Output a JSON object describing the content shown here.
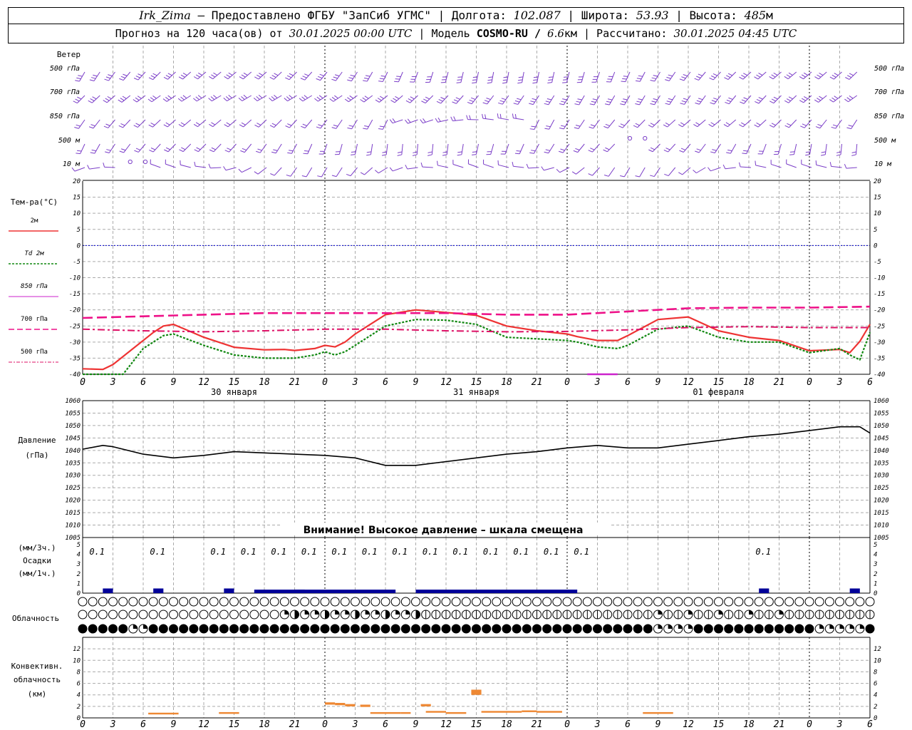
{
  "header": {
    "station": "Irk_Zima",
    "provided_label": "– Предоставлено ФГБУ \"ЗапСиб УГМС\"",
    "lon_label": "| Долгота:",
    "lon_value": "102.087",
    "lat_label": "| Широта:",
    "lat_value": "53.93",
    "alt_label": "| Высота:",
    "alt_value": "485",
    "alt_unit": "м",
    "forecast_label": "Прогноз на 120 часа(ов) от",
    "forecast_start": "30.01.2025 00:00 UTC",
    "model_label": "| Модель",
    "model_name": "COSMO-RU /",
    "model_res": "6.6",
    "model_res_unit": "км",
    "calc_label": "| Рассчитано:",
    "calc_time": "30.01.2025 04:45 UTC"
  },
  "colors": {
    "wind": "#7b3ec8",
    "t2m": "#ee3333",
    "td2m": "#118811",
    "t850": "#cc22cc",
    "t700": "#ee1188",
    "t500": "#dd1166",
    "pressure": "#000000",
    "precip": "#000099",
    "conv": "#ee8833",
    "zero": "#0000cc",
    "grid": "#aaaaaa"
  },
  "chart_data": [
    {
      "type": "wind_barbs",
      "title": "Ветер",
      "levels": [
        "500 гПа",
        "700 гПа",
        "850 гПа",
        "500 м",
        "10  м"
      ],
      "calm_markers_note": "o",
      "description_markers": "barb symbols drawn per 3h step"
    },
    {
      "type": "line",
      "title": "Тем-ра(°C)",
      "ylim": [
        -40,
        20
      ],
      "yticks": [
        20,
        15,
        10,
        5,
        0,
        -5,
        -10,
        -15,
        -20,
        -25,
        -30,
        -35,
        -40
      ],
      "x_ticks": [
        "0",
        "3",
        "6",
        "9",
        "12",
        "15",
        "18",
        "21",
        "0",
        "3",
        "6",
        "9",
        "12",
        "15",
        "18",
        "21",
        "0",
        "3",
        "6",
        "9",
        "12",
        "15",
        "18",
        "21",
        "0",
        "3",
        "6"
      ],
      "x_range_hours": [
        0,
        78
      ],
      "dates": [
        {
          "label": "30 января",
          "hour": 15
        },
        {
          "label": "31 января",
          "hour": 39
        },
        {
          "label": "01 февраля",
          "hour": 63
        }
      ],
      "series": [
        {
          "name": "2м",
          "key": "t2m",
          "x": [
            0,
            2,
            3,
            5,
            7,
            8,
            9,
            12,
            15,
            18,
            20,
            21,
            23,
            24,
            25,
            26,
            27,
            30,
            33,
            36,
            39,
            42,
            45,
            48,
            49,
            51,
            53,
            54,
            57,
            60,
            63,
            66,
            69,
            72,
            75,
            76,
            77,
            78
          ],
          "values": [
            -38.3,
            -38.5,
            -37,
            -32,
            -27,
            -25,
            -24.5,
            -28.5,
            -31.6,
            -32.4,
            -32.3,
            -32.6,
            -32,
            -31,
            -31.5,
            -30,
            -27.5,
            -21.5,
            -20,
            -20.8,
            -21.7,
            -25,
            -26.5,
            -27.5,
            -28.3,
            -29.5,
            -29.5,
            -28,
            -23,
            -22.2,
            -26.5,
            -28.5,
            -29.5,
            -32.7,
            -32.3,
            -33.3,
            -29.8,
            -24.5
          ]
        },
        {
          "name": "Td 2м",
          "key": "td2m",
          "x": [
            0,
            3,
            4,
            6,
            8,
            9,
            12,
            15,
            18,
            21,
            23,
            24,
            25,
            26,
            27,
            30,
            33,
            36,
            39,
            42,
            45,
            48,
            49,
            51,
            53,
            54,
            57,
            60,
            63,
            66,
            69,
            72,
            75,
            76,
            77,
            78
          ],
          "values": [
            -45,
            -43,
            -40,
            -32,
            -28,
            -27.5,
            -31,
            -34,
            -35,
            -35,
            -34,
            -33,
            -34,
            -33,
            -31,
            -25,
            -23,
            -23.2,
            -24.5,
            -28.5,
            -29,
            -29.5,
            -30,
            -31.5,
            -32,
            -31,
            -26,
            -25,
            -28.5,
            -30,
            -30,
            -33.3,
            -32,
            -34,
            -35.5,
            -27
          ]
        },
        {
          "name": "850 гПа",
          "key": "t850",
          "x": [
            50,
            51,
            52,
            53
          ],
          "values": [
            -40,
            -40,
            -40,
            -40
          ]
        },
        {
          "name": "700 гПа",
          "key": "t700",
          "x": [
            0,
            6,
            12,
            18,
            24,
            30,
            36,
            42,
            48,
            54,
            60,
            66,
            72,
            78
          ],
          "values": [
            -22.5,
            -22,
            -21.5,
            -21,
            -21,
            -21,
            -21,
            -21.5,
            -21.5,
            -20.5,
            -19.5,
            -19.3,
            -19.3,
            -19
          ]
        },
        {
          "name": "500 гПа",
          "key": "t500",
          "x": [
            0,
            6,
            12,
            18,
            24,
            30,
            36,
            42,
            48,
            54,
            60,
            66,
            72,
            78
          ],
          "values": [
            -26,
            -26.5,
            -26.8,
            -26.5,
            -26,
            -26,
            -26.5,
            -26.8,
            -26.7,
            -26.2,
            -25.5,
            -25.2,
            -25.5,
            -25.5
          ]
        }
      ]
    },
    {
      "type": "line",
      "title": "Давление",
      "ylabel": "(гПа)",
      "ylim": [
        1005,
        1060
      ],
      "yticks": [
        1060,
        1055,
        1050,
        1045,
        1040,
        1035,
        1030,
        1025,
        1020,
        1015,
        1010,
        1005
      ],
      "notice": "Внимание! Высокое давление – шкала смещена",
      "series": [
        {
          "name": "Давление",
          "x": [
            0,
            2,
            3,
            6,
            9,
            12,
            15,
            18,
            21,
            24,
            27,
            30,
            33,
            36,
            39,
            42,
            45,
            48,
            51,
            54,
            57,
            60,
            63,
            66,
            69,
            72,
            75,
            77,
            78
          ],
          "values": [
            1040.5,
            1042,
            1041.5,
            1038.5,
            1037,
            1038,
            1039.5,
            1039,
            1038.5,
            1038,
            1037,
            1034,
            1034,
            1035.5,
            1037,
            1038.5,
            1039.5,
            1041,
            1042,
            1041,
            1041,
            1042.5,
            1044,
            1045.5,
            1046.5,
            1048,
            1049.5,
            1049.5,
            1047
          ]
        }
      ]
    },
    {
      "type": "bar",
      "title": "Осадки",
      "ylabel_top": "(мм/3ч.)",
      "ylabel_bottom": "(мм/1ч.)",
      "ylim": [
        0,
        5
      ],
      "yticks": [
        5,
        4,
        3,
        2,
        1,
        0
      ],
      "labels": [
        {
          "hour": 1,
          "text": "0.1"
        },
        {
          "hour": 7,
          "text": "0.1"
        },
        {
          "hour": 13,
          "text": "0.1"
        },
        {
          "hour": 16,
          "text": "0.1"
        },
        {
          "hour": 19,
          "text": "0.1"
        },
        {
          "hour": 22,
          "text": "0.1"
        },
        {
          "hour": 25,
          "text": "0.1"
        },
        {
          "hour": 28,
          "text": "0.1"
        },
        {
          "hour": 31,
          "text": "0.1"
        },
        {
          "hour": 34,
          "text": "0.1"
        },
        {
          "hour": 37,
          "text": "0.1"
        },
        {
          "hour": 40,
          "text": "0.1"
        },
        {
          "hour": 43,
          "text": "0.1"
        },
        {
          "hour": 46,
          "text": "0.1"
        },
        {
          "hour": 49,
          "text": "0.1"
        },
        {
          "hour": 67,
          "text": "0.1"
        }
      ],
      "bars": [
        {
          "from": 2,
          "to": 3,
          "value": 0.08
        },
        {
          "from": 7,
          "to": 8,
          "value": 0.08
        },
        {
          "from": 14,
          "to": 15,
          "value": 0.08
        },
        {
          "from": 17,
          "to": 22,
          "value": 0.06
        },
        {
          "from": 21,
          "to": 31,
          "value": 0.06
        },
        {
          "from": 33,
          "to": 49,
          "value": 0.06
        },
        {
          "from": 67,
          "to": 68,
          "value": 0.08
        },
        {
          "from": 76,
          "to": 77,
          "value": 0.08
        }
      ]
    },
    {
      "type": "cloud_symbols",
      "title": "Облачность",
      "rows": 3,
      "step_hours": 1
    },
    {
      "type": "bar",
      "title": "Конвективн. облачность",
      "ylabel": "(км)",
      "ylim": [
        0,
        14
      ],
      "yticks": [
        12,
        10,
        8,
        6,
        4,
        2,
        0
      ],
      "x_ticks": [
        "0",
        "3",
        "6",
        "9",
        "12",
        "15",
        "18",
        "21",
        "0",
        "3",
        "6",
        "9",
        "12",
        "15",
        "18",
        "21",
        "0",
        "3",
        "6",
        "9",
        "12",
        "15",
        "18",
        "21",
        "0",
        "3",
        "6"
      ],
      "segments": [
        {
          "from": 6.5,
          "to": 9.5,
          "bottom": 0.6,
          "top": 0.9
        },
        {
          "from": 13.5,
          "to": 15.5,
          "bottom": 0.7,
          "top": 1.0
        },
        {
          "from": 24,
          "to": 25,
          "bottom": 2.3,
          "top": 2.7
        },
        {
          "from": 25,
          "to": 26,
          "bottom": 2.2,
          "top": 2.6
        },
        {
          "from": 26,
          "to": 27,
          "bottom": 2.0,
          "top": 2.4
        },
        {
          "from": 27.5,
          "to": 28.5,
          "bottom": 1.9,
          "top": 2.3
        },
        {
          "from": 28.5,
          "to": 31.5,
          "bottom": 0.7,
          "top": 1.0
        },
        {
          "from": 31.5,
          "to": 32.5,
          "bottom": 0.7,
          "top": 1.0
        },
        {
          "from": 33.5,
          "to": 34.5,
          "bottom": 2.0,
          "top": 2.4
        },
        {
          "from": 34,
          "to": 36,
          "bottom": 0.9,
          "top": 1.2
        },
        {
          "from": 36,
          "to": 38,
          "bottom": 0.7,
          "top": 1.0
        },
        {
          "from": 38.5,
          "to": 39.5,
          "bottom": 4.0,
          "top": 4.9
        },
        {
          "from": 39.5,
          "to": 43.5,
          "bottom": 0.9,
          "top": 1.2
        },
        {
          "from": 43.5,
          "to": 45,
          "bottom": 1.0,
          "top": 1.3
        },
        {
          "from": 45,
          "to": 47.5,
          "bottom": 0.9,
          "top": 1.2
        },
        {
          "from": 55.5,
          "to": 58.5,
          "bottom": 0.7,
          "top": 1.0
        }
      ]
    }
  ]
}
